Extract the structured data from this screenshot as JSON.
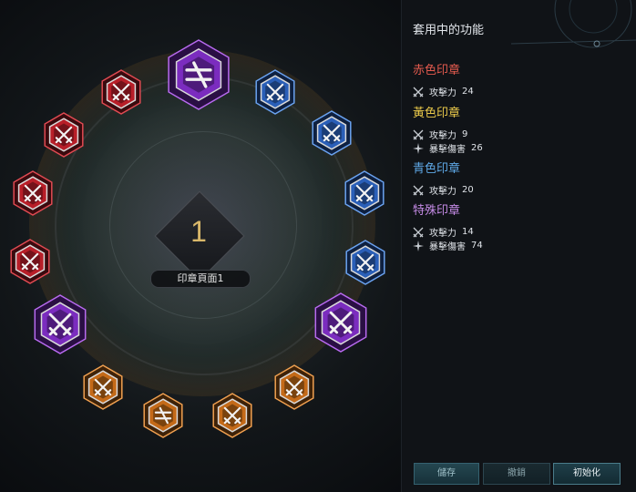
{
  "center": {
    "page_number": "1",
    "page_label": "印章頁面1"
  },
  "panel": {
    "title": "套用中的功能",
    "groups": [
      {
        "name": "赤色印章",
        "color": "#e35a4e",
        "stats": [
          {
            "icon": "crossed-swords-icon",
            "label": "攻擊力",
            "value": "24"
          }
        ]
      },
      {
        "name": "黃色印章",
        "color": "#e9c84a",
        "stats": [
          {
            "icon": "crossed-swords-icon",
            "label": "攻擊力",
            "value": "9"
          },
          {
            "icon": "crit-star-icon",
            "label": "暴擊傷害",
            "value": "26"
          }
        ]
      },
      {
        "name": "青色印章",
        "color": "#5ea8e6",
        "stats": [
          {
            "icon": "crossed-swords-icon",
            "label": "攻擊力",
            "value": "20"
          }
        ]
      },
      {
        "name": "特殊印章",
        "color": "#c58be6",
        "stats": [
          {
            "icon": "crossed-swords-icon",
            "label": "攻擊力",
            "value": "14"
          },
          {
            "icon": "crit-star-icon",
            "label": "暴擊傷害",
            "value": "74"
          }
        ]
      }
    ]
  },
  "buttons": {
    "save": "儲存",
    "cancel": "撤銷",
    "reset": "初始化"
  },
  "seal_colors": {
    "red": "#b81e28",
    "blue": "#2a5fb8",
    "orange": "#c46a18",
    "purple": "#7b2cbf"
  },
  "seals": [
    {
      "color": "purple",
      "icon": "dual-seal-icon"
    },
    {
      "color": "blue",
      "icon": "crossed-swords-icon"
    },
    {
      "color": "blue",
      "icon": "crossed-swords-icon"
    },
    {
      "color": "blue",
      "icon": "crossed-swords-icon"
    },
    {
      "color": "blue",
      "icon": "crossed-swords-icon"
    },
    {
      "color": "purple",
      "icon": "crossed-swords-icon"
    },
    {
      "color": "orange",
      "icon": "crossed-swords-icon"
    },
    {
      "color": "orange",
      "icon": "crossed-swords-icon"
    },
    {
      "color": "orange",
      "icon": "dual-seal-icon"
    },
    {
      "color": "orange",
      "icon": "crossed-swords-icon"
    },
    {
      "color": "purple",
      "icon": "crossed-swords-icon"
    },
    {
      "color": "red",
      "icon": "crossed-swords-icon"
    },
    {
      "color": "red",
      "icon": "crossed-swords-icon"
    },
    {
      "color": "red",
      "icon": "crossed-swords-icon"
    },
    {
      "color": "red",
      "icon": "crossed-swords-icon"
    }
  ]
}
